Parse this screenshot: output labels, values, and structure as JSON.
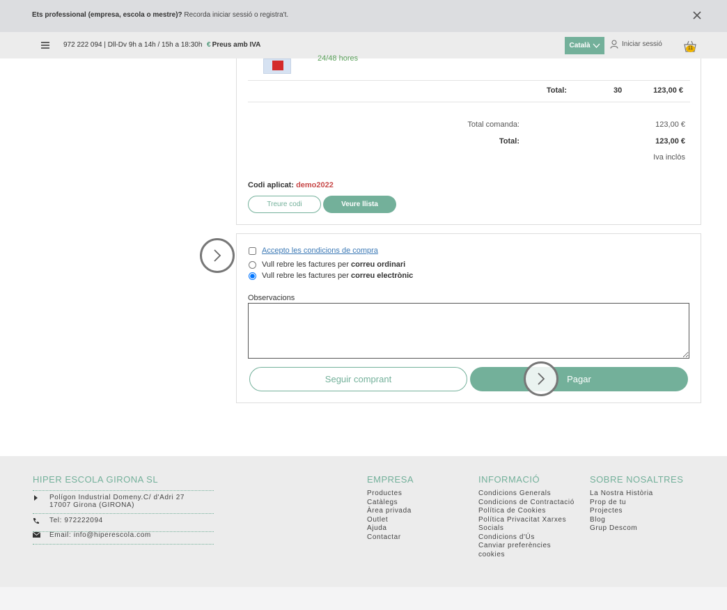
{
  "notice": {
    "bold_text": "Ets professional (empresa, escola o mestre)?",
    "rest_text": " Recorda iniciar sessió o registra't."
  },
  "header": {
    "phone_hours": "972 222 094 | Dll-Dv 9h a 14h / 15h a 18:30h",
    "euro_symbol": "€",
    "prices_iva": "Preus amb IVA",
    "language": "Català",
    "login": "Iniciar sessió",
    "cart_count": "11"
  },
  "order": {
    "delivery_text": "24/48 hores",
    "total_label": "Total:",
    "total_qty": "30",
    "total_price": "123,00 €",
    "order_total_label": "Total comanda:",
    "order_total_value": "123,00 €",
    "grand_total_label": "Total:",
    "grand_total_value": "123,00 €",
    "vat_included": "Iva inclòs",
    "code_label": "Codi aplicat: ",
    "code_value": "demo2022",
    "remove_code_button": "Treure codi",
    "view_list_button": "Veure llista"
  },
  "checkout": {
    "accept_conditions": "Accepto les condicions de compra",
    "invoice_mail_prefix": "Vull rebre les factures per ",
    "invoice_mail_bold": "correu ordinari",
    "invoice_email_prefix": "Vull rebre les factures per ",
    "invoice_email_bold": "correu electrònic",
    "observations_label": "Observacions",
    "continue_shopping_button": "Seguir comprant",
    "pay_button": "Pagar"
  },
  "footer": {
    "company_title": "HIPER ESCOLA GIRONA SL",
    "address_line1": "Polígon Industrial Domeny.C/ d'Adri 27",
    "address_line2": "17007 Girona (GIRONA)",
    "phone": "Tel: 972222094",
    "email": "Email: info@hiperescola.com",
    "empresa_title": "EMPRESA",
    "empresa_links": [
      "Productes",
      "Catàlegs",
      "Àrea privada",
      "Outlet",
      "Ajuda",
      "Contactar"
    ],
    "info_title": "INFORMACIÓ",
    "info_links": [
      "Condicions Generals",
      "Condicions de Contractació",
      "Política de Cookies",
      "Política Privacitat Xarxes",
      "Socials",
      "Condicions d'Ús",
      "Canviar preferències",
      "cookies"
    ],
    "about_title": "SOBRE NOSALTRES",
    "about_links": [
      "La Nostra Història",
      "Prop de tu",
      "Projectes",
      "Blog",
      "Grup Descom"
    ]
  },
  "colors": {
    "accent": "#73b09a",
    "code_red": "#c84a4a",
    "link_blue": "#3a78b5"
  }
}
